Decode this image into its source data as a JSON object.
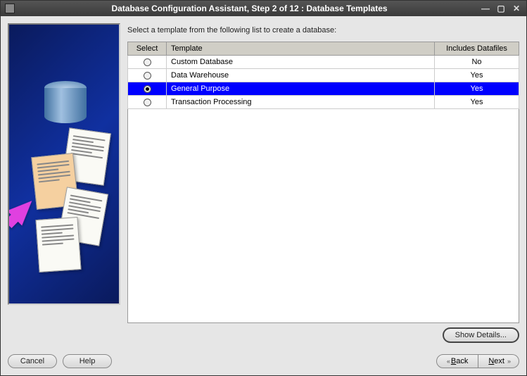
{
  "window": {
    "title": "Database Configuration Assistant, Step 2 of 12 : Database Templates"
  },
  "instruction": "Select a template from the following list to create a database:",
  "table": {
    "headers": {
      "select": "Select",
      "template": "Template",
      "datafiles": "Includes Datafiles"
    },
    "rows": [
      {
        "template": "Custom Database",
        "datafiles": "No",
        "selected": false
      },
      {
        "template": "Data Warehouse",
        "datafiles": "Yes",
        "selected": false
      },
      {
        "template": "General Purpose",
        "datafiles": "Yes",
        "selected": true
      },
      {
        "template": "Transaction Processing",
        "datafiles": "Yes",
        "selected": false
      }
    ]
  },
  "buttons": {
    "show_details": "Show Details...",
    "cancel": "Cancel",
    "help": "Help",
    "back": "Back",
    "next": "Next"
  }
}
